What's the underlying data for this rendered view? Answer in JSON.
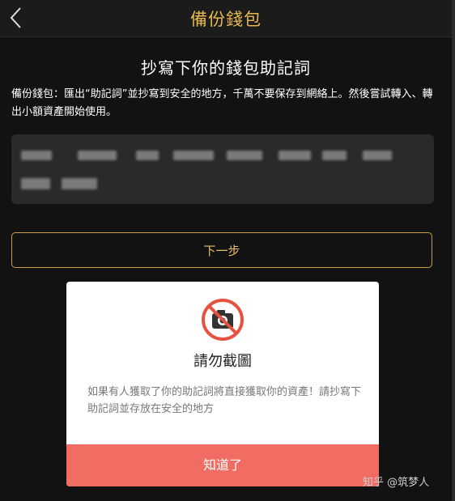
{
  "header": {
    "title": "備份錢包",
    "back_icon": "chevron-left-icon"
  },
  "main": {
    "heading": "抄寫下你的錢包助記詞",
    "description": "備份錢包：匯出“助記詞”並抄寫到安全的地方，千萬不要保存到網絡上。然後嘗試轉入、轉出小額資產開始使用。",
    "next_label": "下一步"
  },
  "modal": {
    "icon": "no-camera-icon",
    "title": "請勿截圖",
    "body": "如果有人獲取了你的助記詞將直接獲取你的資產！請抄寫下助記詞並存放在安全的地方",
    "confirm_label": "知道了"
  },
  "watermark": "知乎 @筑梦人",
  "colors": {
    "accent": "#e7b84e",
    "danger": "#f16d63",
    "background": "#121212"
  }
}
